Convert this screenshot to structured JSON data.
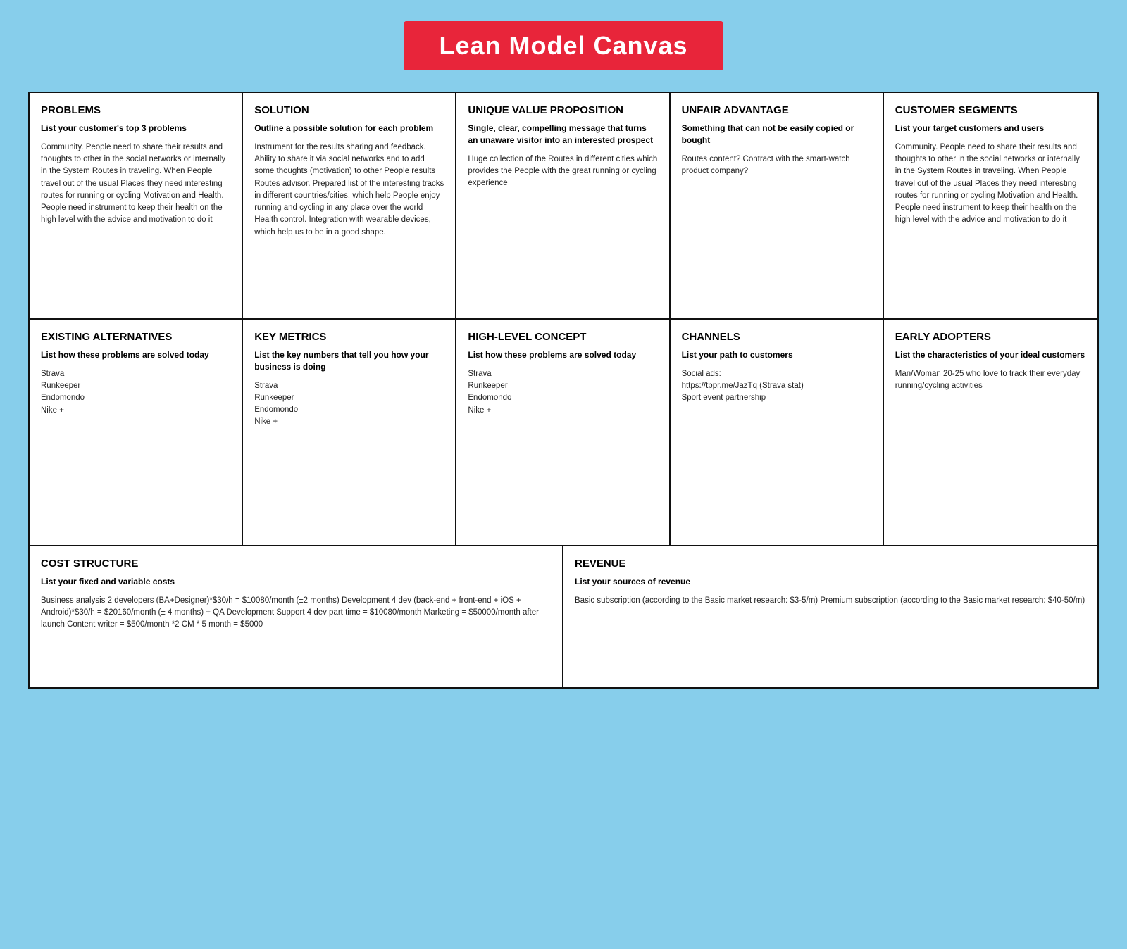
{
  "title": "Lean Model Canvas",
  "cells": {
    "problems": {
      "title": "PROBLEMS",
      "subtitle": "List your customer's top 3 problems",
      "body": "Community. People need to share their results and thoughts to other in the social networks or internally in the System Routes in traveling. When People travel out of the usual Places they need interesting routes for running or cycling Motivation and Health. People need instrument to keep their health on the high level with the advice and motivation to do it"
    },
    "solution": {
      "title": "SOLUTION",
      "subtitle": "Outline a possible solution  for each problem",
      "body": "Instrument for the results sharing and feedback. Ability to share it via social networks and to add some thoughts (motivation) to other People results Routes advisor. Prepared list of the interesting tracks in different countries/cities, which help People enjoy running and cycling in any place over the world Health control. Integration with wearable devices, which help us to be in a good shape."
    },
    "uvp": {
      "title": "UNIQUE VALUE PROPOSITION",
      "subtitle": "Single, clear, compelling message that turns an unaware visitor into an interested prospect",
      "body": "Huge collection of the Routes in different cities which provides the People with the great running or cycling experience"
    },
    "unfair": {
      "title": "UNFAIR ADVANTAGE",
      "subtitle": "Something that can not be easily copied or bought",
      "body": "Routes content?  Contract with the smart-watch product company?"
    },
    "customer_segments": {
      "title": "CUSTOMER SEGMENTS",
      "subtitle": "List your target customers and users",
      "body": "Community. People need to share their results and thoughts to other in the social networks or internally in the System Routes in traveling. When People travel out of the usual Places they need interesting routes for running or cycling Motivation and Health. People need instrument to keep their health on the high level with the advice and motivation to do it"
    },
    "existing_alternatives": {
      "title": "EXISTING ALTERNATIVES",
      "subtitle": "List how these problems are solved today",
      "items": [
        "Strava",
        "Runkeeper",
        "Endomondo",
        "Nike +"
      ]
    },
    "key_metrics": {
      "title": "KEY METRICS",
      "subtitle": "List the key numbers that tell you how your business is doing",
      "items": [
        "Strava",
        "Runkeeper",
        "Endomondo",
        "Nike +"
      ]
    },
    "high_level": {
      "title": "HIGH-LEVEL CONCEPT",
      "subtitle": "List how these problems are solved today",
      "items": [
        "Strava",
        "Runkeeper",
        "Endomondo",
        "Nike +"
      ]
    },
    "channels": {
      "title": "CHANNELS",
      "subtitle": "List your path to customers",
      "body": "Social ads:\nhttps://tppr.me/JazTq (Strava stat)\nSport event partnership"
    },
    "early_adopters": {
      "title": "EARLY ADOPTERS",
      "subtitle": "List the characteristics of your ideal customers",
      "body": "Man/Woman 20-25 who love to track their everyday running/cycling activities"
    },
    "cost_structure": {
      "title": "COST STRUCTURE",
      "subtitle": "List your fixed and variable costs",
      "body": "Business analysis 2 developers (BA+Designer)*$30/h = $10080/month (±2 months) Development 4 dev (back-end + front-end + iOS + Android)*$30/h = $20160/month (± 4 months) + QA Development Support 4 dev part time = $10080/month Marketing = $50000/month after launch  Content writer = $500/month *2 CM * 5 month = $5000"
    },
    "revenue": {
      "title": "REVENUE",
      "subtitle": "List your sources of revenue",
      "body": "Basic subscription (according to the Basic market research: $3-5/m) Premium subscription (according to the Basic market research: $40-50/m)"
    }
  }
}
